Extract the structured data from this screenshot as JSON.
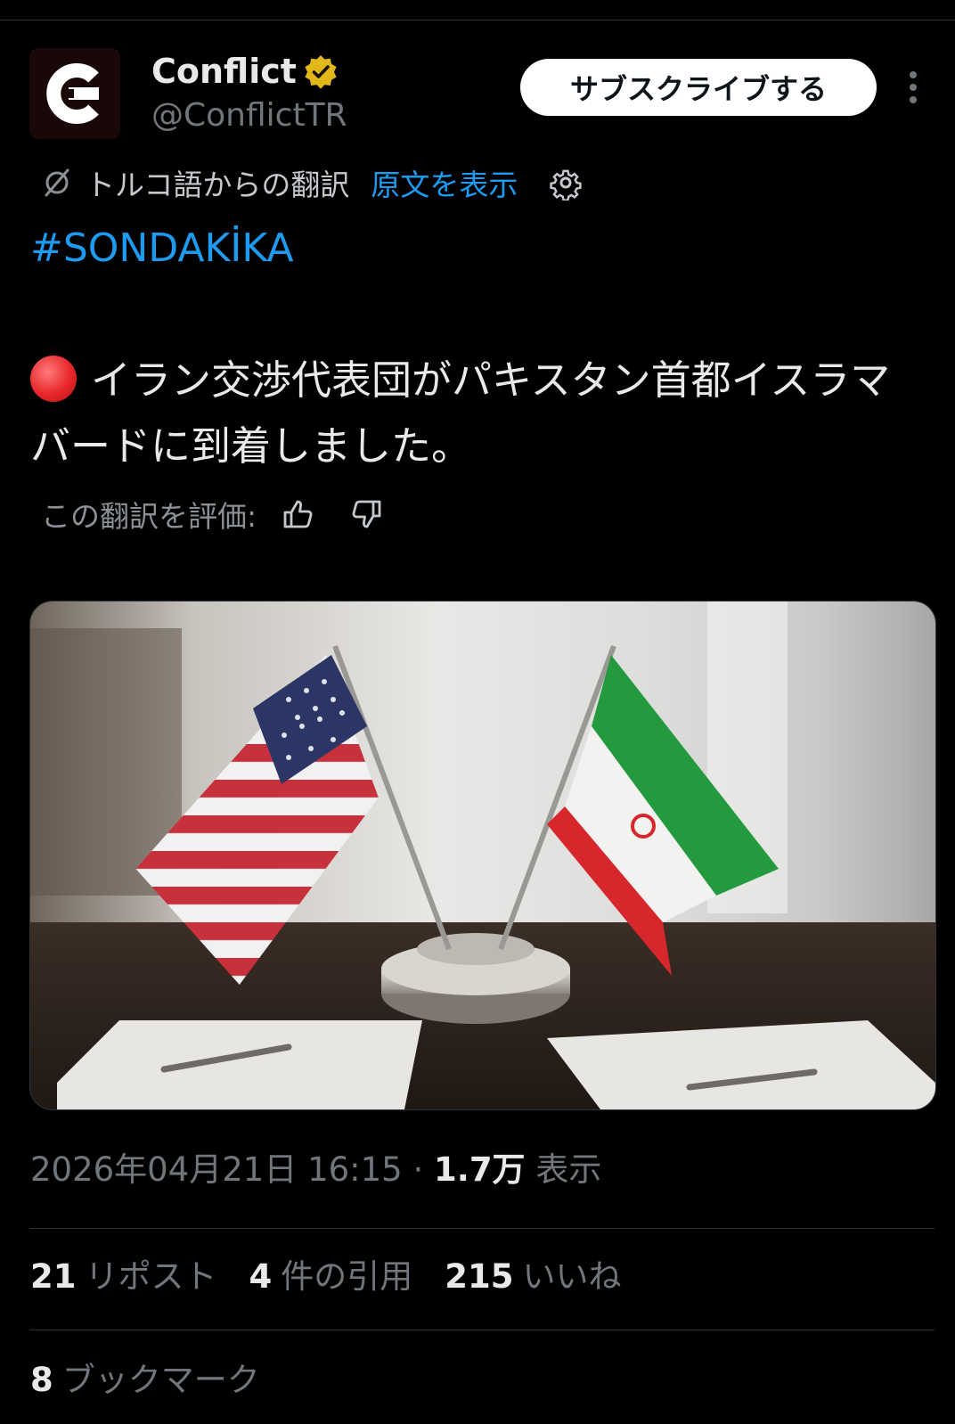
{
  "author": {
    "display_name": "Conflict",
    "handle": "@ConflictTR",
    "avatar_letter": "C"
  },
  "header": {
    "subscribe_label": "サブスクライブする"
  },
  "translation": {
    "label": "トルコ語からの翻訳",
    "show_original": "原文を表示"
  },
  "tweet": {
    "hashtag": "#SONDAKİKA",
    "text": "イラン交渉代表団がパキスタン首都イスラマバードに到着しました。"
  },
  "rating": {
    "label": "この翻訳を評価:"
  },
  "meta": {
    "timestamp": "2026年04月21日 16:15",
    "separator": "·",
    "views_count": "1.7万",
    "views_label": "表示"
  },
  "stats": {
    "reposts_count": "21",
    "reposts_label": "リポスト",
    "quotes_count": "4",
    "quotes_label": "件の引用",
    "likes_count": "215",
    "likes_label": "いいね",
    "bookmarks_count": "8",
    "bookmarks_label": "ブックマーク"
  },
  "icons": {
    "verified": "verified-badge-icon",
    "more": "more-vertical-icon",
    "translate": "translate-icon",
    "settings": "gear-icon",
    "thumbs_up": "thumbs-up-icon",
    "thumbs_down": "thumbs-down-icon",
    "status_dot": "red-circle-icon"
  },
  "colors": {
    "background": "#000000",
    "link": "#1d9bf0",
    "secondary_text": "#71767b",
    "verified_gold": "#e2b719"
  }
}
